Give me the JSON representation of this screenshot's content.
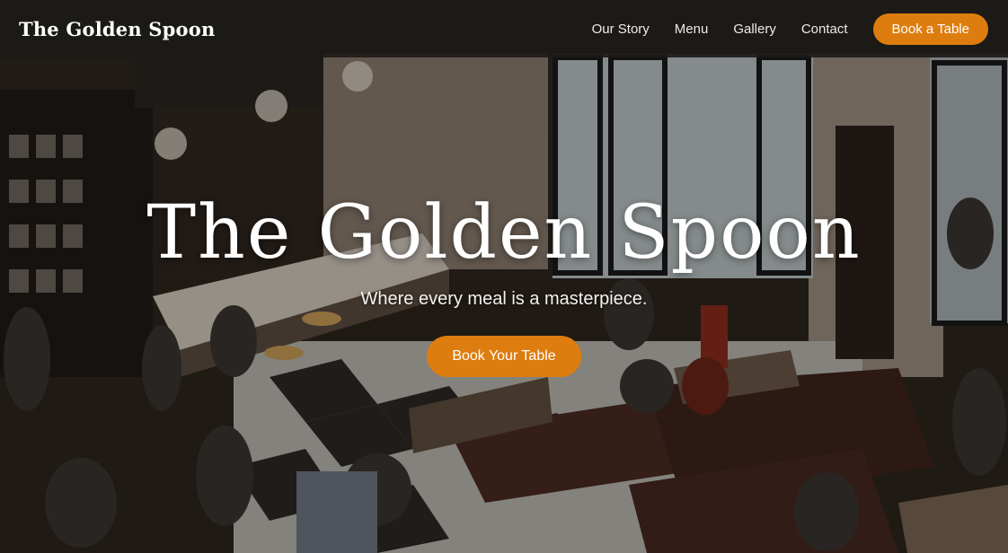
{
  "navbar": {
    "brand": "The Golden Spoon",
    "links": [
      "Our Story",
      "Menu",
      "Gallery",
      "Contact"
    ],
    "cta_label": "Book a Table"
  },
  "hero": {
    "title": "The Golden Spoon",
    "tagline": "Where every meal is a masterpiece.",
    "cta_label": "Book Your Table",
    "background_image": "restaurant-interior-photo"
  },
  "colors": {
    "accent": "#de7d0f",
    "navbar_bg": "#1c1a18",
    "text": "#ffffff"
  }
}
